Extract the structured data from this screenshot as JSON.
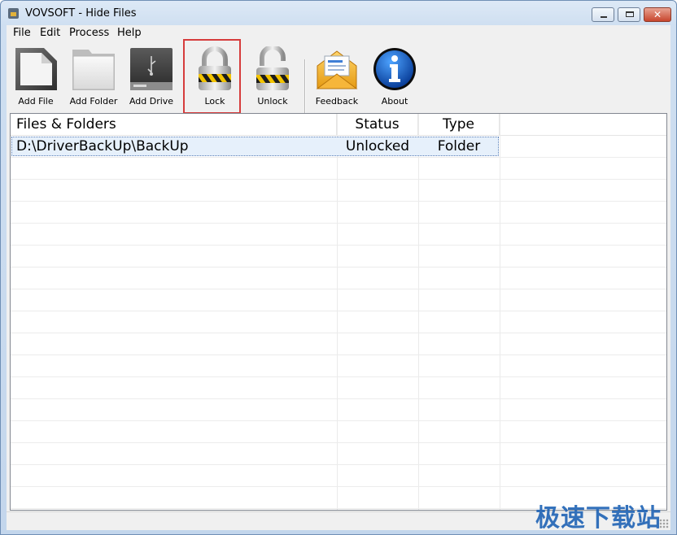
{
  "window": {
    "title": "VOVSOFT - Hide Files"
  },
  "window_controls": {
    "minimize": "",
    "maximize": "",
    "close": "✕"
  },
  "menu": [
    {
      "label": "File"
    },
    {
      "label": "Edit"
    },
    {
      "label": "Process"
    },
    {
      "label": "Help"
    }
  ],
  "toolbar": {
    "add_file": {
      "label": "Add File",
      "icon": "document-icon"
    },
    "add_folder": {
      "label": "Add Folder",
      "icon": "folder-icon"
    },
    "add_drive": {
      "label": "Add Drive",
      "icon": "usb-drive-icon"
    },
    "lock": {
      "label": "Lock",
      "icon": "padlock-closed-icon"
    },
    "unlock": {
      "label": "Unlock",
      "icon": "padlock-open-icon"
    },
    "feedback": {
      "label": "Feedback",
      "icon": "envelope-icon"
    },
    "about": {
      "label": "About",
      "icon": "info-icon"
    }
  },
  "list": {
    "columns": [
      "Files & Folders",
      "Status",
      "Type"
    ],
    "rows": [
      {
        "path": "D:\\DriverBackUp\\BackUp",
        "status": "Unlocked",
        "type": "Folder"
      }
    ]
  },
  "watermark": "极速下载站",
  "colors": {
    "accent_highlight": "#d63c3c",
    "selection": "#e6f0fb",
    "info_blue": "#1a5fc8"
  }
}
